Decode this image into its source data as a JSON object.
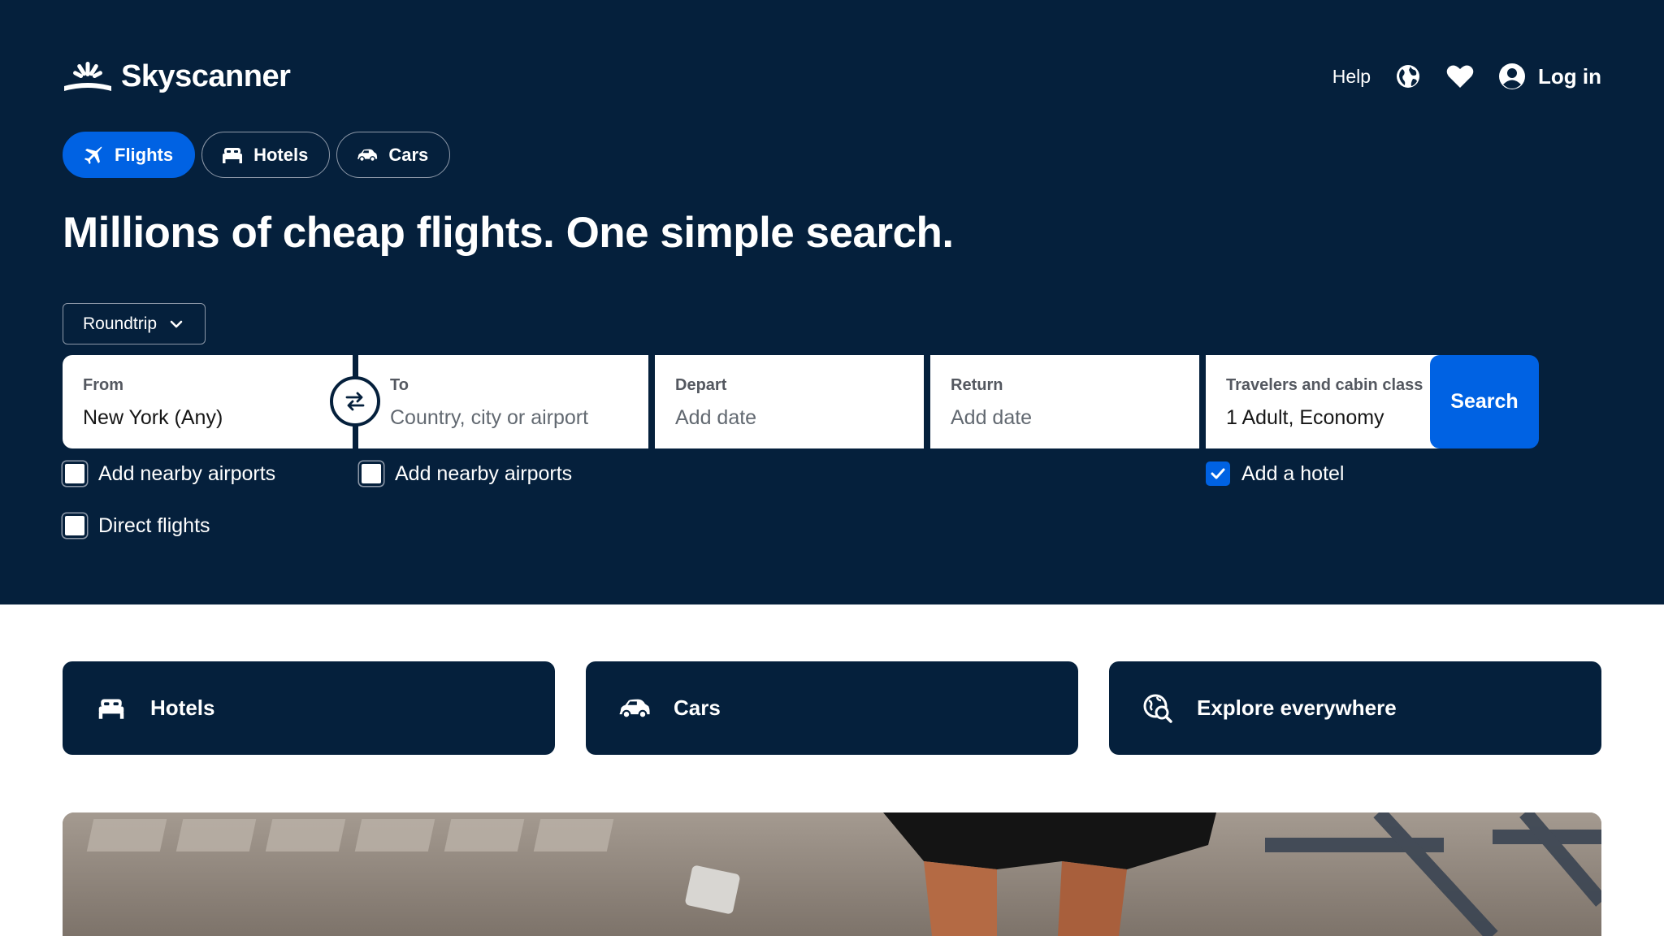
{
  "brand": {
    "name": "Skyscanner"
  },
  "header": {
    "help_label": "Help",
    "icons": [
      "globe-icon",
      "heart-icon",
      "user-icon"
    ],
    "login_label": "Log in"
  },
  "tabs": [
    {
      "label": "Flights",
      "icon": "plane-icon",
      "active": true
    },
    {
      "label": "Hotels",
      "icon": "bed-icon",
      "active": false
    },
    {
      "label": "Cars",
      "icon": "car-icon",
      "active": false
    }
  ],
  "headline": "Millions of cheap flights. One simple search.",
  "search": {
    "trip_type": "Roundtrip",
    "from": {
      "label": "From",
      "value": "New York (Any)"
    },
    "to": {
      "label": "To",
      "placeholder": "Country, city or airport"
    },
    "depart": {
      "label": "Depart",
      "placeholder": "Add date"
    },
    "return": {
      "label": "Return",
      "placeholder": "Add date"
    },
    "travelers": {
      "label": "Travelers and cabin class",
      "value": "1 Adult, Economy"
    },
    "search_label": "Search"
  },
  "options": {
    "from_nearby": {
      "label": "Add nearby airports",
      "checked": false
    },
    "to_nearby": {
      "label": "Add nearby airports",
      "checked": false
    },
    "add_hotel": {
      "label": "Add a hotel",
      "checked": true
    },
    "direct": {
      "label": "Direct flights",
      "checked": false
    }
  },
  "quick_links": [
    {
      "label": "Hotels",
      "icon": "bed-icon"
    },
    {
      "label": "Cars",
      "icon": "car-icon"
    },
    {
      "label": "Explore everywhere",
      "icon": "explore-icon"
    }
  ],
  "colors": {
    "navy": "#05203c",
    "accent_blue": "#0062e3",
    "white": "#ffffff"
  }
}
